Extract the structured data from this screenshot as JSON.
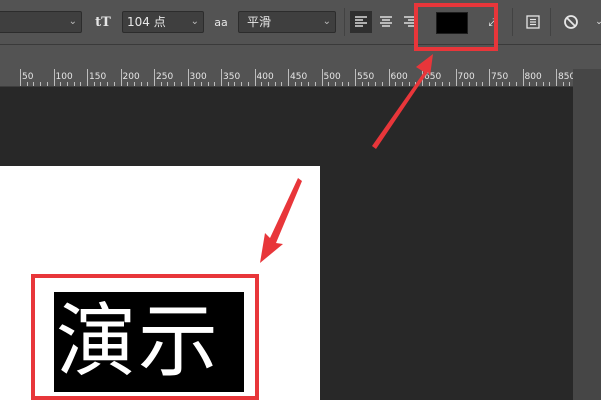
{
  "toolbar": {
    "font_size_icon": "tT",
    "font_size_value": "104 点",
    "antialias_icon": "aa",
    "antialias_value": "平滑",
    "align_left_icon": "align-left-icon",
    "align_center_icon": "align-center-icon",
    "align_right_icon": "align-right-icon",
    "text_color": "#000000",
    "warp_icon": "warp-text-icon",
    "panel_icon": "character-panel-icon",
    "cancel_icon": "cancel-icon"
  },
  "ruler": {
    "labels": [
      "50",
      "100",
      "150",
      "200",
      "250",
      "300",
      "350",
      "400",
      "450",
      "500",
      "550",
      "600",
      "650",
      "700",
      "750",
      "800",
      "850"
    ]
  },
  "document": {
    "text": "演示",
    "background": "#ffffff"
  },
  "annotations": {
    "highlight_color": "#e8363a"
  }
}
